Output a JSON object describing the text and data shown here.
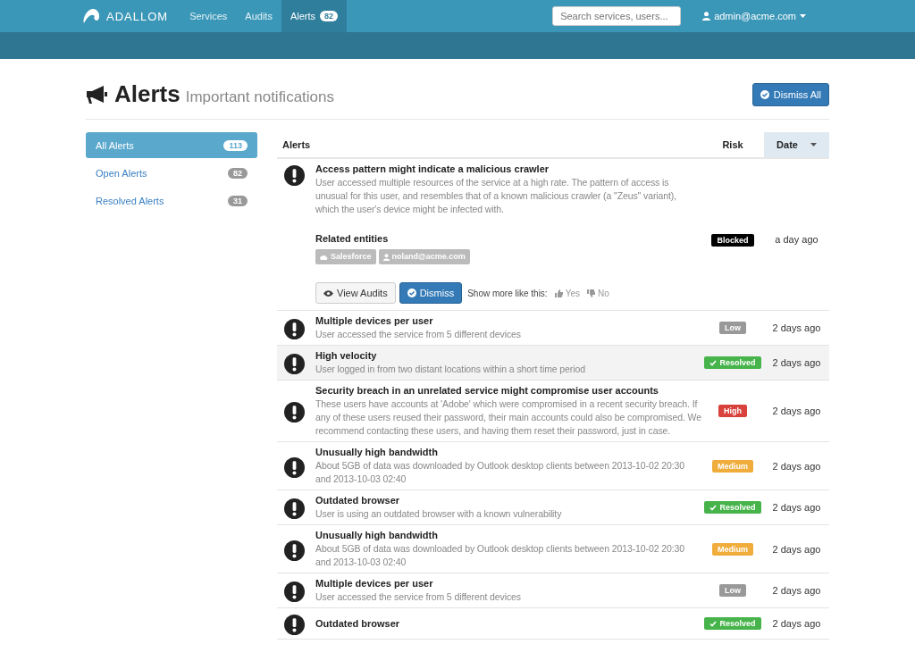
{
  "navbar": {
    "brand": "ADALLOM",
    "links": [
      {
        "label": "Services",
        "selected": false
      },
      {
        "label": "Audits",
        "selected": false
      },
      {
        "label": "Alerts",
        "selected": true,
        "badge": "82"
      }
    ],
    "search": {
      "placeholder": "Search services, users..."
    },
    "user": "admin@acme.com"
  },
  "header": {
    "title": "Alerts",
    "subtitle": "Important notifications",
    "dismiss_all": "Dismiss All"
  },
  "sidebar": {
    "items": [
      {
        "label": "All Alerts",
        "count": "113",
        "selected": true
      },
      {
        "label": "Open Alerts",
        "count": "82",
        "selected": false
      },
      {
        "label": "Resolved Alerts",
        "count": "31",
        "selected": false
      }
    ]
  },
  "table": {
    "columns": [
      {
        "label": "Alerts",
        "sorted": false
      },
      {
        "label": "Risk",
        "sorted": false
      },
      {
        "label": "Date",
        "sorted": true
      }
    ],
    "rows": [
      {
        "title": "Access pattern might indicate a malicious crawler",
        "description": "User accessed multiple resources of the service at a high rate. The pattern of access is unusual for this user, and resembles that of a known malicious crawler (a \"Zeus\" variant), which the user's device might be infected with.",
        "risk": {
          "label": "Blocked",
          "kind": "blocked"
        },
        "date": "a day ago",
        "selected": false,
        "expanded": true,
        "details": {
          "heading": "Related entities",
          "entities": [
            {
              "kind": "service",
              "label": "Salesforce"
            },
            {
              "kind": "user",
              "label": "noland@acme.com"
            }
          ],
          "view_audits": "View Audits",
          "dismiss": "Dismiss",
          "feedback_label": "Show more like this:",
          "yes": "Yes",
          "no": "No"
        }
      },
      {
        "title": "Multiple devices per user",
        "description": "User accessed the service from 5 different devices",
        "risk": {
          "label": "Low",
          "kind": "low"
        },
        "date": "2 days ago",
        "selected": false,
        "expanded": false
      },
      {
        "title": "High velocity",
        "description": "User logged in from two distant locations within a short time period",
        "risk": {
          "label": "Resolved",
          "kind": "resolved"
        },
        "date": "2 days ago",
        "selected": true,
        "expanded": false
      },
      {
        "title": "Security breach in an unrelated service might compromise user accounts",
        "description": "These users have accounts at 'Adobe' which were compromised in a recent security breach. If any of these users reused their password, their main accounts could also be compromised. We recommend contacting these users, and having them reset their password, just in case.",
        "risk": {
          "label": "High",
          "kind": "high"
        },
        "date": "2 days ago",
        "selected": false,
        "expanded": false
      },
      {
        "title": "Unusually high bandwidth",
        "description": "About 5GB of data was downloaded by Outlook desktop clients between 2013-10-02 20:30 and 2013-10-03 02:40",
        "risk": {
          "label": "Medium",
          "kind": "medium"
        },
        "date": "2 days ago",
        "selected": false,
        "expanded": false
      },
      {
        "title": "Outdated browser",
        "description": "User is using an outdated browser with a known vulnerability",
        "risk": {
          "label": "Resolved",
          "kind": "resolved"
        },
        "date": "2 days ago",
        "selected": false,
        "expanded": false
      },
      {
        "title": "Unusually high bandwidth",
        "description": "About 5GB of data was downloaded by Outlook desktop clients between 2013-10-02 20:30 and 2013-10-03 02:40",
        "risk": {
          "label": "Medium",
          "kind": "medium"
        },
        "date": "2 days ago",
        "selected": false,
        "expanded": false
      },
      {
        "title": "Multiple devices per user",
        "description": "User accessed the service from 5 different devices",
        "risk": {
          "label": "Low",
          "kind": "low"
        },
        "date": "2 days ago",
        "selected": false,
        "expanded": false
      },
      {
        "title": "Outdated browser",
        "risk": {
          "label": "Resolved",
          "kind": "resolved"
        },
        "date": "2 days ago",
        "selected": false,
        "expanded": false
      }
    ]
  }
}
